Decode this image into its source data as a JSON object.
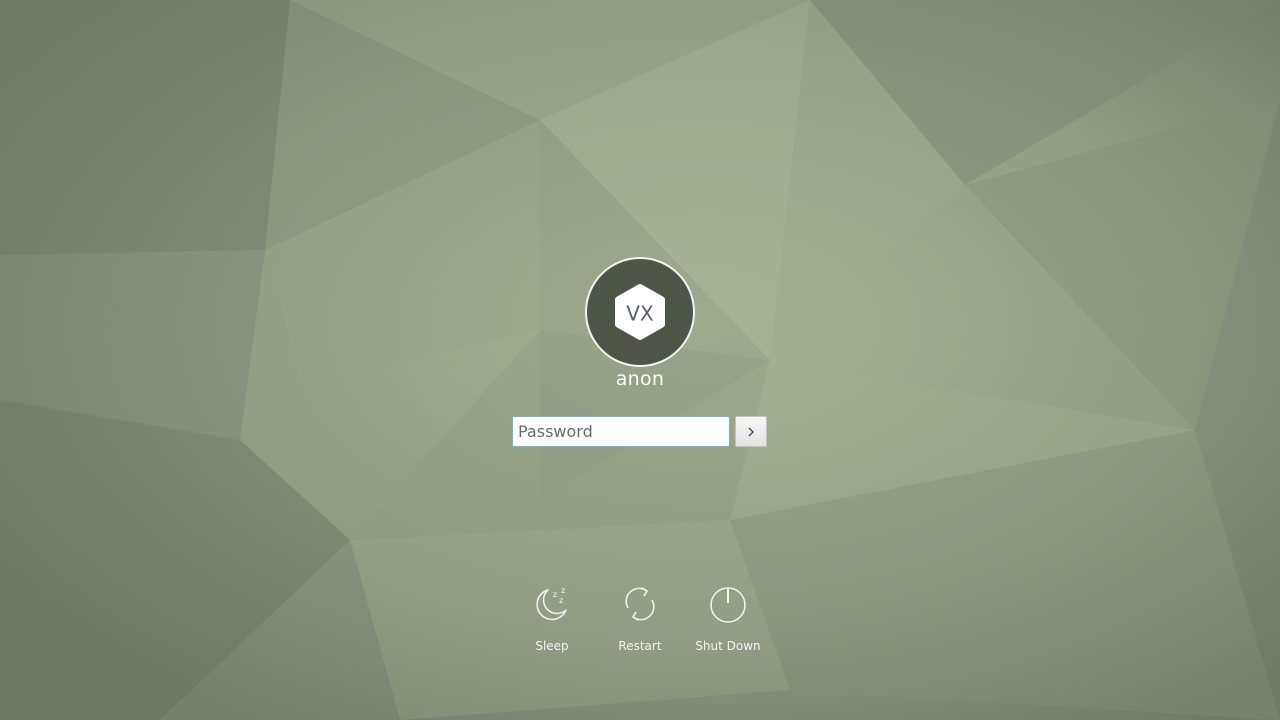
{
  "user": {
    "initials": "VX",
    "name": "anon"
  },
  "login": {
    "password_placeholder": "Password",
    "submit_icon": "chevron-right-icon"
  },
  "power_actions": [
    {
      "label": "Sleep",
      "icon": "sleep-moon-icon"
    },
    {
      "label": "Restart",
      "icon": "restart-icon"
    },
    {
      "label": "Shut Down",
      "icon": "power-icon"
    }
  ],
  "theme": {
    "wallpaper_base": "#8e9a7f",
    "input_focus_border": "#6fb3d6",
    "avatar_bg": "#4d5448",
    "text_color": "#ffffff"
  }
}
